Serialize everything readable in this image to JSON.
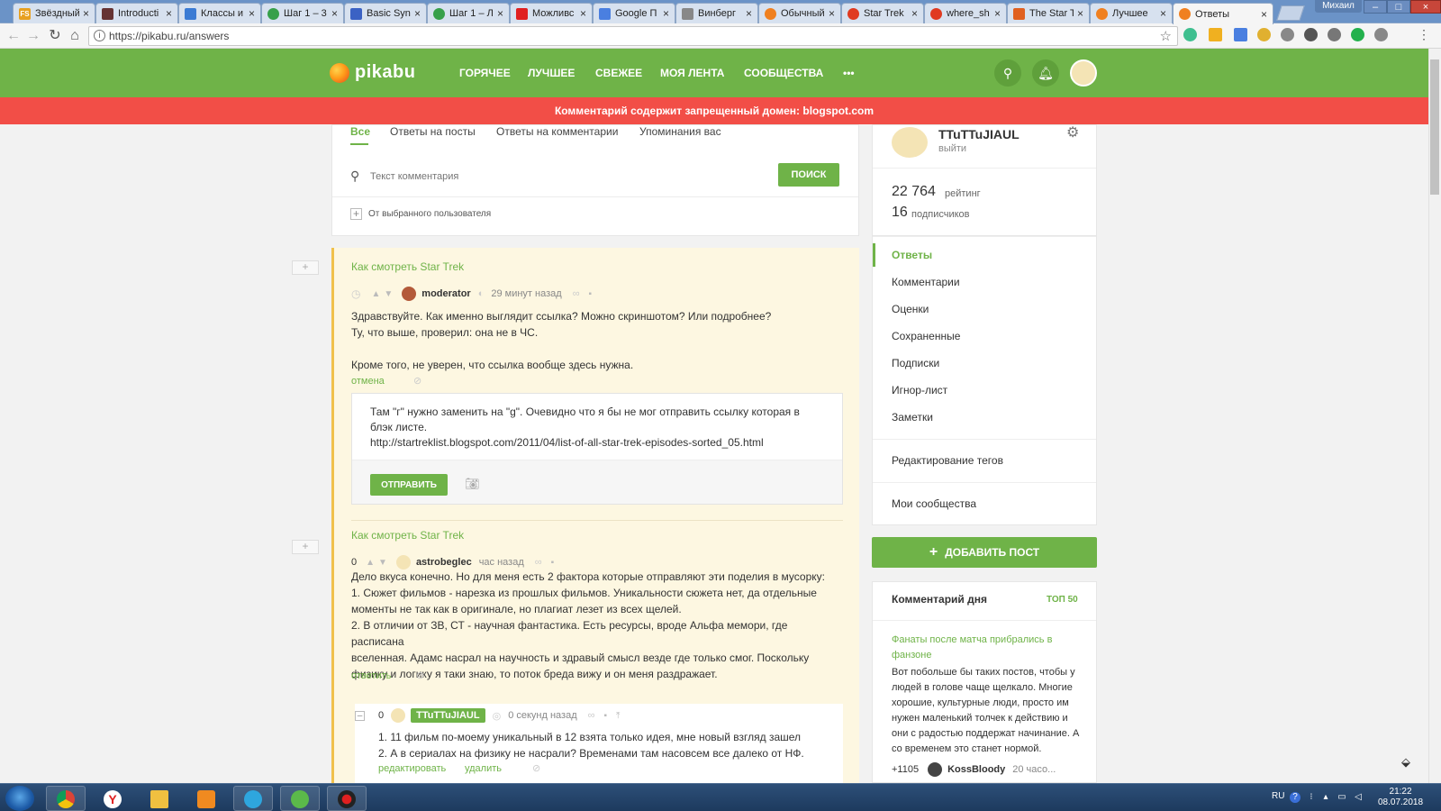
{
  "browser": {
    "tabs": [
      {
        "title": "Звёздный",
        "icon_color": "#e8a020",
        "icon_glyph": "FS"
      },
      {
        "title": "Introducti",
        "icon_color": "#663333",
        "icon_glyph": ""
      },
      {
        "title": "Классы и",
        "icon_color": "#3b7bd4",
        "icon_glyph": ""
      },
      {
        "title": "Шаг 1 – 3",
        "icon_color": "#37a04a",
        "icon_glyph": ""
      },
      {
        "title": "Basic Synt",
        "icon_color": "#3b62c4",
        "icon_glyph": ""
      },
      {
        "title": "Шаг 1 – Л",
        "icon_color": "#37a04a",
        "icon_glyph": ""
      },
      {
        "title": "Можливс",
        "icon_color": "#e02020",
        "icon_glyph": ""
      },
      {
        "title": "Google П",
        "icon_color": "#4a7fe0",
        "icon_glyph": ""
      },
      {
        "title": "Винберг",
        "icon_color": "#888888",
        "icon_glyph": ""
      },
      {
        "title": "Обычный",
        "icon_color": "#f08020",
        "icon_glyph": ""
      },
      {
        "title": "Star Trek",
        "icon_color": "#e03a20",
        "icon_glyph": ""
      },
      {
        "title": "where_sh",
        "icon_color": "#e03a20",
        "icon_glyph": ""
      },
      {
        "title": "The Star T",
        "icon_color": "#e06020",
        "icon_glyph": ""
      },
      {
        "title": "Лучшее",
        "icon_color": "#f08020",
        "icon_glyph": ""
      },
      {
        "title": "Ответы",
        "icon_color": "#f08020",
        "icon_glyph": "",
        "active": true
      }
    ],
    "window_user": "Михаил",
    "url": "https://pikabu.ru/answers"
  },
  "site": {
    "logo_text": "pikabu",
    "nav": [
      "ГОРЯЧЕЕ",
      "ЛУЧШЕЕ",
      "СВЕЖЕЕ",
      "МОЯ ЛЕНТА",
      "СООБЩЕСТВА",
      "•••"
    ],
    "alert": "Комментарий содержит запрещенный домен: blogspot.com",
    "brand_color": "#6fb348",
    "alert_color": "#f24e47"
  },
  "filters": {
    "tabs": [
      "Все",
      "Ответы на посты",
      "Ответы на комментарии",
      "Упоминания вас"
    ],
    "search_placeholder": "Текст комментария",
    "search_button": "ПОИСК",
    "from_user": "От выбранного пользователя"
  },
  "feed": [
    {
      "post_title": "Как смотреть Star Trek",
      "author": "moderator",
      "time": "29 минут назад",
      "text": [
        "Здравствуйте. Как именно выглядит ссылка? Можно скриншотом? Или подробнее?",
        "Ту, что выше, проверил: она не в ЧС.",
        "",
        "Кроме того, не уверен, что ссылка вообще здесь нужна."
      ],
      "action": "отмена",
      "reply_text": [
        "Там \"г\" нужно заменить на \"g\". Очевидно что я бы не мог отправить ссылку которая в блэк листе.",
        "http://startreklist.blogspot.com/2011/04/list-of-all-star-trek-episodes-sorted_05.html"
      ],
      "reply_button": "ОТПРАВИТЬ"
    },
    {
      "post_title": "Как смотреть Star Trek",
      "rating": "0",
      "author": "astrobeglec",
      "time": "час назад",
      "text": [
        "Дело вкуса конечно. Но для меня есть 2 фактора которые отправляют эти поделия в мусорку:",
        "1. Сюжет фильмов - нарезка из прошлых фильмов. Уникальности сюжета нет, да отдельные",
        "моменты не так как в оригинале, но плагиат лезет из всех щелей.",
        "2. В отличии от ЗВ, СТ - научная фантастика. Есть ресурсы, вроде Альфа мемори, где расписана",
        "вселенная. Адамс насрал на научность и здравый смысл везде где только смог. Поскольку",
        "физику и логику я таки знаю, то поток бреда вижу и он меня раздражает."
      ],
      "action": "ответить",
      "reply": {
        "rating": "0",
        "author": "TTuTTuJIAUL",
        "time": "0 секунд назад",
        "text": [
          "1. 11 фильм по-моему уникальный в 12 взята только идея, мне новый взгляд зашел",
          "2. А в сериалах на физику не насрали? Временами там насовсем все далеко от НФ."
        ],
        "edit": "редактировать",
        "delete": "удалить"
      }
    }
  ],
  "profile": {
    "name": "TTuTTuJIAUL",
    "logout": "выйти",
    "rating_value": "22 764",
    "rating_label": "рейтинг",
    "subs_value": "16",
    "subs_label": "подписчиков"
  },
  "menu": {
    "items": [
      "Ответы",
      "Комментарии",
      "Оценки",
      "Сохраненные",
      "Подписки",
      "Игнор-лист",
      "Заметки"
    ],
    "edit_tags": "Редактирование тегов",
    "my_communities": "Мои сообщества",
    "add_post": "ДОБАВИТЬ ПОСТ"
  },
  "comment_of_day": {
    "header": "Комментарий дня",
    "top": "ТОП 50",
    "title": "Фанаты после матча прибрались в фанзоне",
    "text": "Вот побольше бы таких постов, чтобы у людей в голове чаще щелкало. Многие хорошие, культурные люди, просто им нужен маленький толчек к действию и они с радостью поддержат начинание. А со временем это станет нормой.",
    "score": "+1105",
    "author": "KossBloody",
    "time": "20 часо..."
  },
  "taskbar": {
    "lang": "RU",
    "time": "21:22",
    "date": "08.07.2018"
  }
}
